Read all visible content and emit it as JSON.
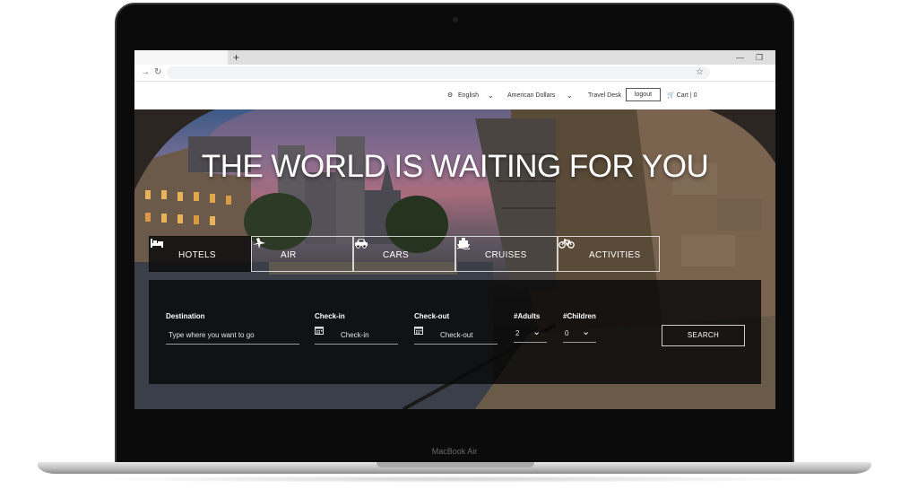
{
  "device": {
    "label": "MacBook Air"
  },
  "browser": {
    "new_tab_symbol": "+",
    "back_icon": "arrow-right-icon",
    "reload_icon": "reload-icon",
    "bookmark_icon": "star-icon",
    "minimize_symbol": "—",
    "restore_symbol": "❐"
  },
  "header": {
    "language": "English",
    "currency": "American Dollars",
    "travel_desk": "Travel Desk",
    "logout": "logout",
    "cart_label": "Cart",
    "cart_separator": "|",
    "cart_count": "0"
  },
  "hero": {
    "title": "THE WORLD IS WAITING FOR YOU"
  },
  "tabs": [
    {
      "label": "HOTELS",
      "icon": "bed-icon",
      "active": true
    },
    {
      "label": "AIR",
      "icon": "plane-icon",
      "active": false
    },
    {
      "label": "CARS",
      "icon": "car-icon",
      "active": false
    },
    {
      "label": "CRUISES",
      "icon": "ship-icon",
      "active": false
    },
    {
      "label": "ACTIVITIES",
      "icon": "bicycle-icon",
      "active": false
    }
  ],
  "search": {
    "destination_label": "Destination",
    "destination_placeholder": "Type where you want to go",
    "checkin_label": "Check-in",
    "checkin_placeholder": "Check-in",
    "checkout_label": "Check-out",
    "checkout_placeholder": "Check-out",
    "adults_label": "#Adults",
    "adults_value": "2",
    "children_label": "#Children",
    "children_value": "0",
    "button_label": "SEARCH"
  },
  "colors": {
    "panel_bg": "#0a0a0a",
    "text_primary": "#ffffff",
    "header_text": "#333333"
  }
}
